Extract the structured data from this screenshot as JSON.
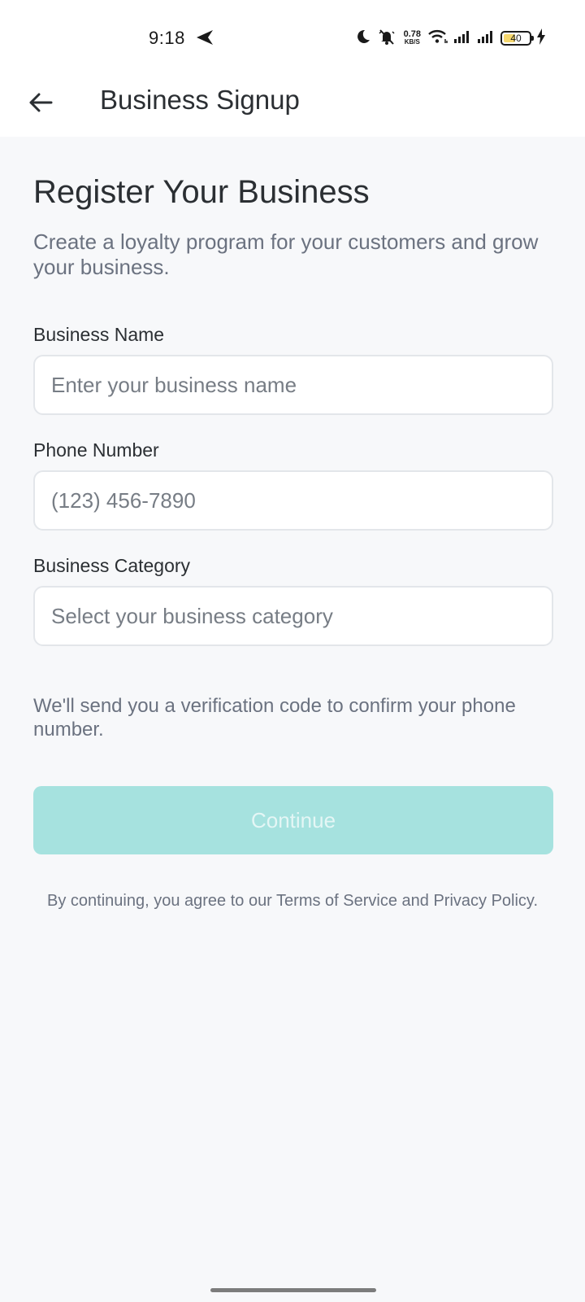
{
  "status_bar": {
    "time": "9:18",
    "net_speed_value": "0.78",
    "net_speed_unit": "KB/S",
    "battery_level": "40",
    "icons": [
      "navigation-arrow-icon",
      "moon-icon",
      "bell-off-icon",
      "wifi-icon",
      "signal-icon",
      "signal-icon",
      "charging-icon"
    ]
  },
  "app_bar": {
    "title": "Business Signup",
    "back_icon": "arrow-left-icon"
  },
  "main": {
    "heading": "Register Your Business",
    "subtitle": "Create a loyalty program for your customers and grow your business.",
    "fields": [
      {
        "label": "Business Name",
        "placeholder": "Enter your business name"
      },
      {
        "label": "Phone Number",
        "placeholder": "(123) 456-7890"
      },
      {
        "label": "Business Category",
        "placeholder": "Select your business category"
      }
    ],
    "note": "We'll send you a verification code to confirm your phone number.",
    "continue_label": "Continue",
    "terms": "By continuing, you agree to our Terms of Service and Privacy Policy."
  },
  "colors": {
    "accent_disabled": "#a6e2df",
    "background": "#f7f8fa",
    "field_border": "#e3e6ea"
  }
}
